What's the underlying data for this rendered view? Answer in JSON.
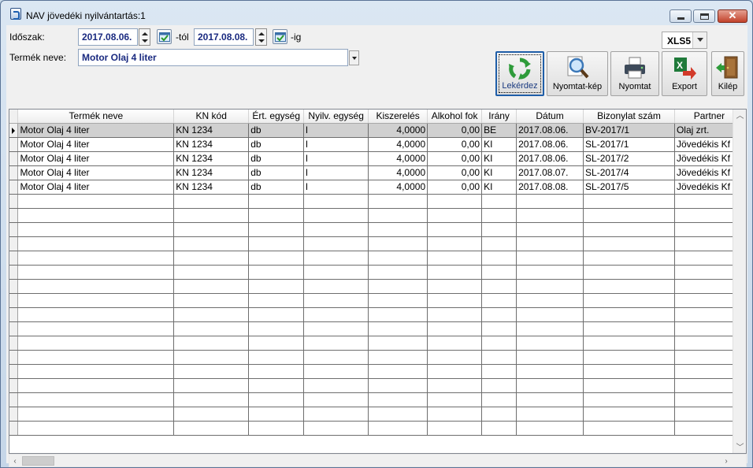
{
  "window": {
    "title": "NAV jövedéki nyilvántartás:1",
    "minimize_icon": "minimize-icon",
    "maximize_icon": "maximize-icon",
    "close_icon": "close-icon"
  },
  "filters": {
    "period_label": "Időszak:",
    "date_from": "2017.08.06.",
    "from_suffix": "-tól",
    "date_to": "2017.08.08.",
    "to_suffix": "-ig",
    "product_label": "Termék neve:",
    "product_value": "Motor Olaj 4 liter"
  },
  "export_format": {
    "selected": "XLS5"
  },
  "toolbar": {
    "query_label": "Lekérdez",
    "print_preview_label": "Nyomtat-kép",
    "print_label": "Nyomtat",
    "export_label": "Export",
    "exit_label": "Kilép"
  },
  "grid": {
    "columns": [
      "Termék neve",
      "KN kód",
      "Ért. egység",
      "Nyilv. egység",
      "Kiszerelés",
      "Alkohol fok",
      "Irány",
      "Dátum",
      "Bizonylat szám",
      "Partner"
    ],
    "rows": [
      [
        "Motor Olaj 4 liter",
        "KN 1234",
        "db",
        "l",
        "4,0000",
        "0,00",
        "BE",
        "2017.08.06.",
        "BV-2017/1",
        "Olaj zrt."
      ],
      [
        "Motor Olaj 4 liter",
        "KN 1234",
        "db",
        "l",
        "4,0000",
        "0,00",
        "KI",
        "2017.08.06.",
        "SL-2017/1",
        "Jövedékis Kf"
      ],
      [
        "Motor Olaj 4 liter",
        "KN 1234",
        "db",
        "l",
        "4,0000",
        "0,00",
        "KI",
        "2017.08.06.",
        "SL-2017/2",
        "Jövedékis Kf"
      ],
      [
        "Motor Olaj 4 liter",
        "KN 1234",
        "db",
        "l",
        "4,0000",
        "0,00",
        "KI",
        "2017.08.07.",
        "SL-2017/4",
        "Jövedékis Kf"
      ],
      [
        "Motor Olaj 4 liter",
        "KN 1234",
        "db",
        "l",
        "4,0000",
        "0,00",
        "KI",
        "2017.08.08.",
        "SL-2017/5",
        "Jövedékis Kf"
      ]
    ],
    "selected_row": 0
  },
  "colors": {
    "accent": "#1f5ea8",
    "field_text": "#1a2a80",
    "selected_row": "#d0d0d0"
  }
}
